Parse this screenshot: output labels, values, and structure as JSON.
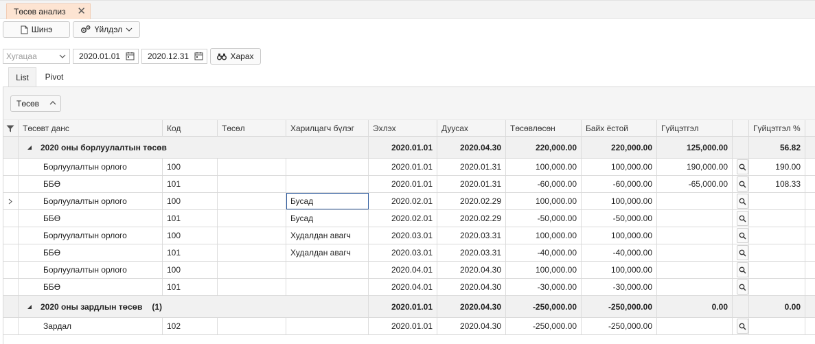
{
  "tab": {
    "title": "Төсөв анализ",
    "close": "✕"
  },
  "toolbar": {
    "new_label": "Шинэ",
    "actions_label": "Үйлдэл"
  },
  "filter": {
    "period_placeholder": "Хугацаа",
    "date_from": "2020.01.01",
    "date_to": "2020.12.31",
    "view_label": "Харах"
  },
  "view_tabs": {
    "list": "List",
    "pivot": "Pivot"
  },
  "group_chip": "Төсөв",
  "columns": {
    "account": "Төсөвт данс",
    "code": "Код",
    "project": "Төсөл",
    "customer_group": "Харилцагч бүлэг",
    "start": "Эхлэх",
    "end": "Дуусах",
    "planned": "Төсөвлөсөн",
    "expected": "Байх ёстой",
    "actual": "Гүйцэтгэл",
    "actual_pct": "Гүйцэтгэл %"
  },
  "groups": [
    {
      "name": "2020 оны борлуулалтын төсөв",
      "start": "2020.01.01",
      "end": "2020.04.30",
      "planned": "220,000.00",
      "expected": "220,000.00",
      "actual": "125,000.00",
      "actual_pct": "56.82",
      "rows": [
        {
          "account": "Борлуулалтын орлого",
          "code": "100",
          "project": "",
          "customer_group": "",
          "start": "2020.01.01",
          "end": "2020.01.31",
          "planned": "100,000.00",
          "expected": "100,000.00",
          "actual": "190,000.00",
          "actual_pct": "190.00"
        },
        {
          "account": "ББӨ",
          "code": "101",
          "project": "",
          "customer_group": "",
          "start": "2020.01.01",
          "end": "2020.01.31",
          "planned": "-60,000.00",
          "expected": "-60,000.00",
          "actual": "-65,000.00",
          "actual_pct": "108.33"
        },
        {
          "account": "Борлуулалтын орлого",
          "code": "100",
          "project": "",
          "customer_group": "Бусад",
          "start": "2020.02.01",
          "end": "2020.02.29",
          "planned": "100,000.00",
          "expected": "100,000.00",
          "actual": "",
          "actual_pct": ""
        },
        {
          "account": "ББӨ",
          "code": "101",
          "project": "",
          "customer_group": "Бусад",
          "start": "2020.02.01",
          "end": "2020.02.29",
          "planned": "-50,000.00",
          "expected": "-50,000.00",
          "actual": "",
          "actual_pct": ""
        },
        {
          "account": "Борлуулалтын орлого",
          "code": "100",
          "project": "",
          "customer_group": "Худалдан авагч",
          "start": "2020.03.01",
          "end": "2020.03.31",
          "planned": "100,000.00",
          "expected": "100,000.00",
          "actual": "",
          "actual_pct": ""
        },
        {
          "account": "ББӨ",
          "code": "101",
          "project": "",
          "customer_group": "Худалдан авагч",
          "start": "2020.03.01",
          "end": "2020.03.31",
          "planned": "-40,000.00",
          "expected": "-40,000.00",
          "actual": "",
          "actual_pct": ""
        },
        {
          "account": "Борлуулалтын орлого",
          "code": "100",
          "project": "",
          "customer_group": "",
          "start": "2020.04.01",
          "end": "2020.04.30",
          "planned": "100,000.00",
          "expected": "100,000.00",
          "actual": "",
          "actual_pct": ""
        },
        {
          "account": "ББӨ",
          "code": "101",
          "project": "",
          "customer_group": "",
          "start": "2020.04.01",
          "end": "2020.04.30",
          "planned": "-30,000.00",
          "expected": "-30,000.00",
          "actual": "",
          "actual_pct": ""
        }
      ]
    },
    {
      "name": "2020 оны зардлын төсөв",
      "count": "(1)",
      "start": "2020.01.01",
      "end": "2020.04.30",
      "planned": "-250,000.00",
      "expected": "-250,000.00",
      "actual": "0.00",
      "actual_pct": "0.00",
      "rows": [
        {
          "account": "Зардал",
          "code": "102",
          "project": "",
          "customer_group": "",
          "start": "2020.01.01",
          "end": "2020.04.30",
          "planned": "-250,000.00",
          "expected": "-250,000.00",
          "actual": "",
          "actual_pct": ""
        }
      ]
    }
  ]
}
